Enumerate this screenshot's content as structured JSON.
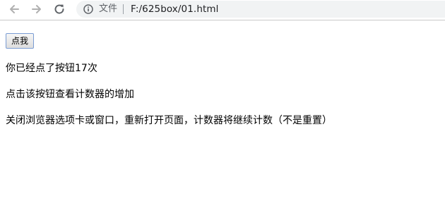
{
  "browser": {
    "scheme_label": "文件",
    "url": "F:/625box/01.html"
  },
  "page": {
    "button_label": "点我",
    "result_text": "你已经点了按钮17次",
    "hint_1": "点击该按钮查看计数器的增加",
    "hint_2": "关闭浏览器选项卡或窗口，重新打开页面，计数器将继续计数（不是重置）"
  }
}
